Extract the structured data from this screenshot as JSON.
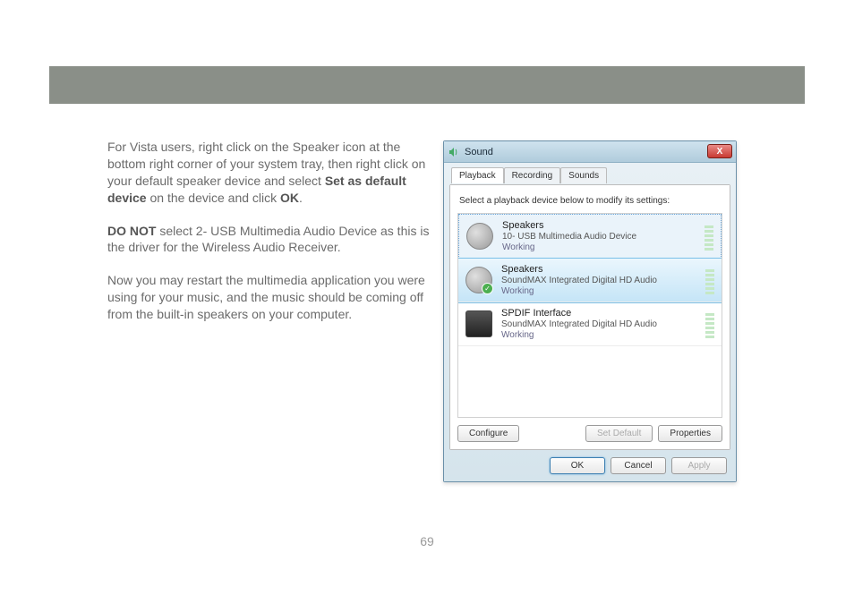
{
  "page_number": "69",
  "paragraphs": {
    "p1_a": "For Vista users, right click on the Speaker icon at the bottom right corner of your system tray, then right click on your default speaker device and select ",
    "p1_bold1": "Set as default device",
    "p1_b": " on the device and click ",
    "p1_bold2": "OK",
    "p1_c": ".",
    "p2_bold": "DO NOT",
    "p2_rest": " select 2- USB Multimedia Audio Device as this is the driver for the Wireless Audio Receiver.",
    "p3": "Now you may restart the multimedia application you were using for your music, and the music should be coming off from the built-in speakers on your computer."
  },
  "dialog": {
    "title": "Sound",
    "close": "X",
    "tabs": [
      "Playback",
      "Recording",
      "Sounds"
    ],
    "instruction": "Select a playback device below to modify its settings:",
    "devices": [
      {
        "name": "Speakers",
        "desc": "10- USB Multimedia Audio Device",
        "status": "Working",
        "selected": true,
        "default": false,
        "type": "speaker"
      },
      {
        "name": "Speakers",
        "desc": "SoundMAX Integrated Digital HD Audio",
        "status": "Working",
        "selected": false,
        "default": true,
        "highlighted": true,
        "type": "speaker"
      },
      {
        "name": "SPDIF Interface",
        "desc": "SoundMAX Integrated Digital HD Audio",
        "status": "Working",
        "selected": false,
        "default": false,
        "type": "spdif"
      }
    ],
    "buttons": {
      "configure": "Configure",
      "set_default": "Set Default",
      "properties": "Properties",
      "ok": "OK",
      "cancel": "Cancel",
      "apply": "Apply"
    }
  }
}
